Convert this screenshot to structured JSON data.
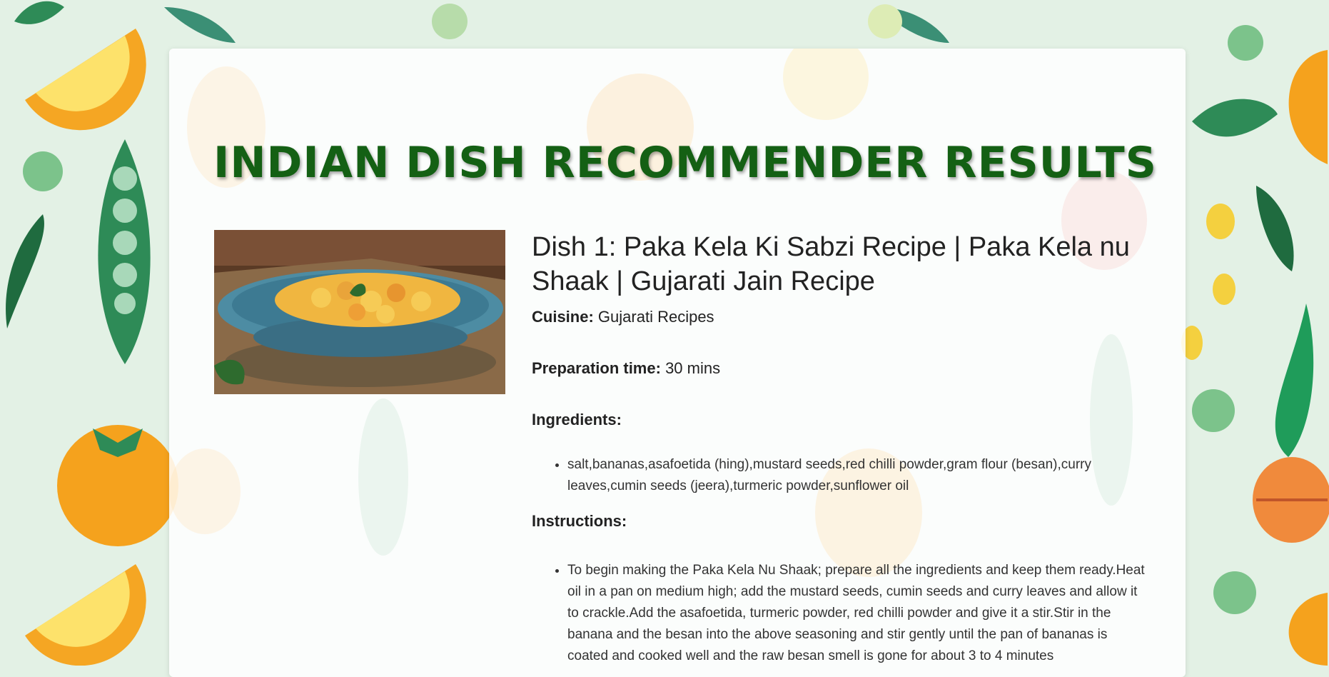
{
  "page": {
    "title": "INDIAN DISH RECOMMENDER RESULTS"
  },
  "dish": {
    "title": "Dish 1: Paka Kela Ki Sabzi Recipe | Paka Kela nu Shaak | Gujarati Jain Recipe",
    "cuisine_label": "Cuisine:",
    "cuisine_value": "Gujarati Recipes",
    "prep_label": "Preparation time:",
    "prep_value": "30 mins",
    "ingredients_label": "Ingredients:",
    "ingredients": "salt,bananas,asafoetida (hing),mustard seeds,red chilli powder,gram flour (besan),curry leaves,cumin seeds (jeera),turmeric powder,sunflower oil",
    "instructions_label": "Instructions:",
    "instructions": "To begin making the Paka Kela Nu Shaak; prepare all the ingredients and keep them ready.Heat oil in a pan on medium high; add the mustard seeds, cumin seeds and curry leaves and allow it to crackle.Add the asafoetida, turmeric powder, red chilli powder and give it a stir.Stir in the banana and the besan into the above seasoning and stir gently until the pan of bananas is coated and cooked well and the raw besan smell is gone for about 3 to 4 minutes"
  },
  "colors": {
    "title_green": "#146014",
    "background": "#e3f1e5"
  }
}
